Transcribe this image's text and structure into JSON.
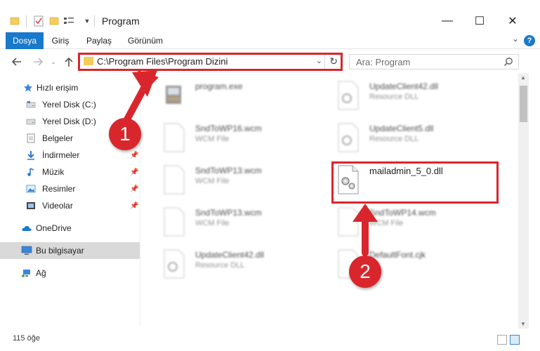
{
  "window": {
    "title": "Program",
    "minimize": "—",
    "maximize": "☐",
    "close": "✕"
  },
  "ribbon": {
    "tabs": [
      {
        "label": "Dosya",
        "active": true
      },
      {
        "label": "Giriş"
      },
      {
        "label": "Paylaş"
      },
      {
        "label": "Görünüm"
      }
    ],
    "help": "?"
  },
  "nav": {
    "address": "C:\\Program Files\\Program Dizini",
    "search_placeholder": "Ara: Program"
  },
  "sidebar": {
    "items": [
      {
        "label": "Hızlı erişim",
        "icon": "star-icon"
      },
      {
        "label": "Yerel Disk (C:)",
        "icon": "drive-icon"
      },
      {
        "label": "Yerel Disk (D:)",
        "icon": "drive-icon"
      },
      {
        "label": "Belgeler",
        "icon": "documents-icon"
      },
      {
        "label": "İndirmeler",
        "icon": "download-icon"
      },
      {
        "label": "Müzik",
        "icon": "music-icon"
      },
      {
        "label": "Resimler",
        "icon": "pictures-icon"
      },
      {
        "label": "Videolar",
        "icon": "videos-icon"
      },
      {
        "label": "OneDrive",
        "icon": "cloud-icon"
      },
      {
        "label": "Bu bilgisayar",
        "icon": "computer-icon"
      },
      {
        "label": "Ağ",
        "icon": "network-icon"
      }
    ]
  },
  "files": [
    {
      "name": "program.exe",
      "type": ""
    },
    {
      "name": "SndToWP16.wcm",
      "type": "WCM File"
    },
    {
      "name": "SndToWP13.wcm",
      "type": "WCM File"
    },
    {
      "name": "SndToWP13.wcm",
      "type": "WCM File"
    },
    {
      "name": "UpdateClient42.dll",
      "type": "Resource DLL"
    },
    {
      "name": "UpdateClient42.dll",
      "type": "Resource DLL"
    },
    {
      "name": "UpdateClient5.dll",
      "type": "Resource DLL"
    },
    {
      "name": "mailadmin_5_0.dll",
      "type": ""
    },
    {
      "name": "SndToWP14.wcm",
      "type": "WCM File"
    },
    {
      "name": "DefaultFont.cjk",
      "type": ""
    }
  ],
  "status": {
    "count": "115 öğe"
  },
  "callouts": [
    "1",
    "2"
  ],
  "colors": {
    "accent": "#1979ca",
    "highlight": "#d9262c",
    "folder": "#f7cd5a"
  }
}
